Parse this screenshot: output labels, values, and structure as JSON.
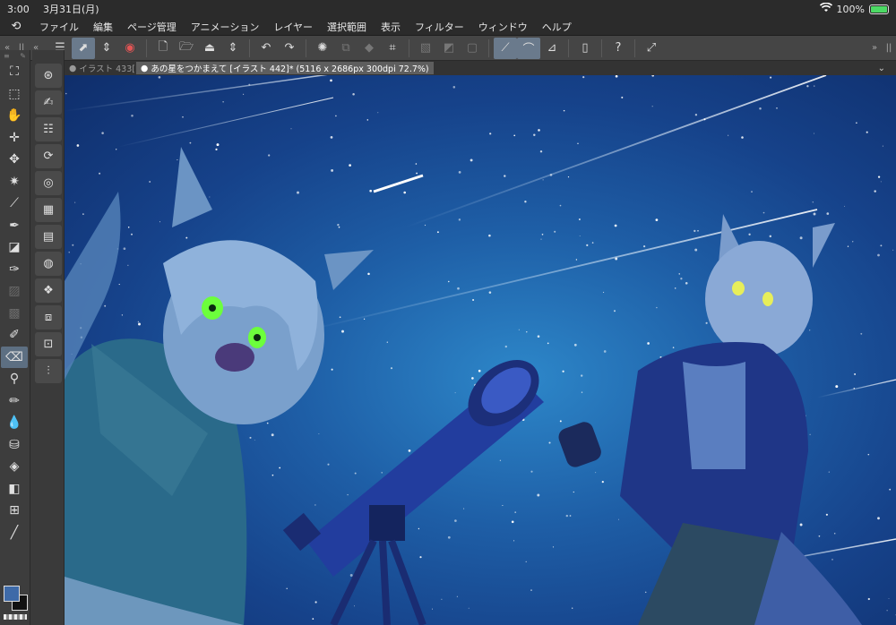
{
  "status_bar": {
    "time": "3:00",
    "date": "3月31日(月)",
    "battery": "100%",
    "battery_level": 1.0
  },
  "menu": {
    "logo_icon": "clip-studio-icon",
    "items": [
      "ファイル",
      "編集",
      "ページ管理",
      "アニメーション",
      "レイヤー",
      "選択範囲",
      "表示",
      "フィルター",
      "ウィンドウ",
      "ヘルプ"
    ]
  },
  "command_bar": {
    "panel_toggles": [
      "«",
      "||",
      "«"
    ],
    "icons": [
      "menu-icon",
      "brush-settings-icon",
      "up-down-arrow-icon",
      "record-icon",
      "new-file-icon",
      "open-folder-icon",
      "save-icon",
      "up-down-arrow-icon",
      "undo-icon",
      "redo-icon",
      "loading-icon",
      "transform-icon",
      "fill-icon",
      "crop-icon",
      "clear-icon",
      "invert-icon",
      "deselect-icon",
      "snap-ruler-icon",
      "snap-special-icon",
      "snap-grid-icon",
      "tablet-icon",
      "help-icon",
      "fullscreen-icon"
    ],
    "right_toggles": [
      "»",
      "||"
    ]
  },
  "tabs": [
    {
      "label": "イラスト 433[",
      "active": false
    },
    {
      "label": "あの星をつかまえて [イラスト 442]* (5116 x 2686px 300dpi 72.7%)",
      "active": true
    }
  ],
  "tools": [
    "move-layer-icon",
    "selection-icon",
    "hand-icon",
    "crosshair-icon",
    "transform-move-icon",
    "magic-wand-icon",
    "eyedropper-icon",
    "pen-icon",
    "color-blend-icon",
    "ink-icon",
    "airbrush-icon",
    "gradient-icon",
    "pencil-icon",
    "eraser-icon",
    "zoom-icon",
    "pen-tool-icon",
    "blend-drops-icon",
    "text-bucket-icon",
    "fill-bucket-icon",
    "gradient-square-icon",
    "frame-icon",
    "line-icon"
  ],
  "sub_tools": [
    "navigator-icon",
    "sub-tool-pen-icon",
    "tool-property-icon",
    "brush-size-icon",
    "color-wheel-icon",
    "color-set-icon",
    "intermediate-color-icon",
    "color-history-icon",
    "layer-icon",
    "layer-property-icon",
    "material-icon",
    "adjust-icon"
  ],
  "colors": {
    "main": "#3e6aa8",
    "sub": "#111111",
    "accent": "#5d6f82"
  }
}
